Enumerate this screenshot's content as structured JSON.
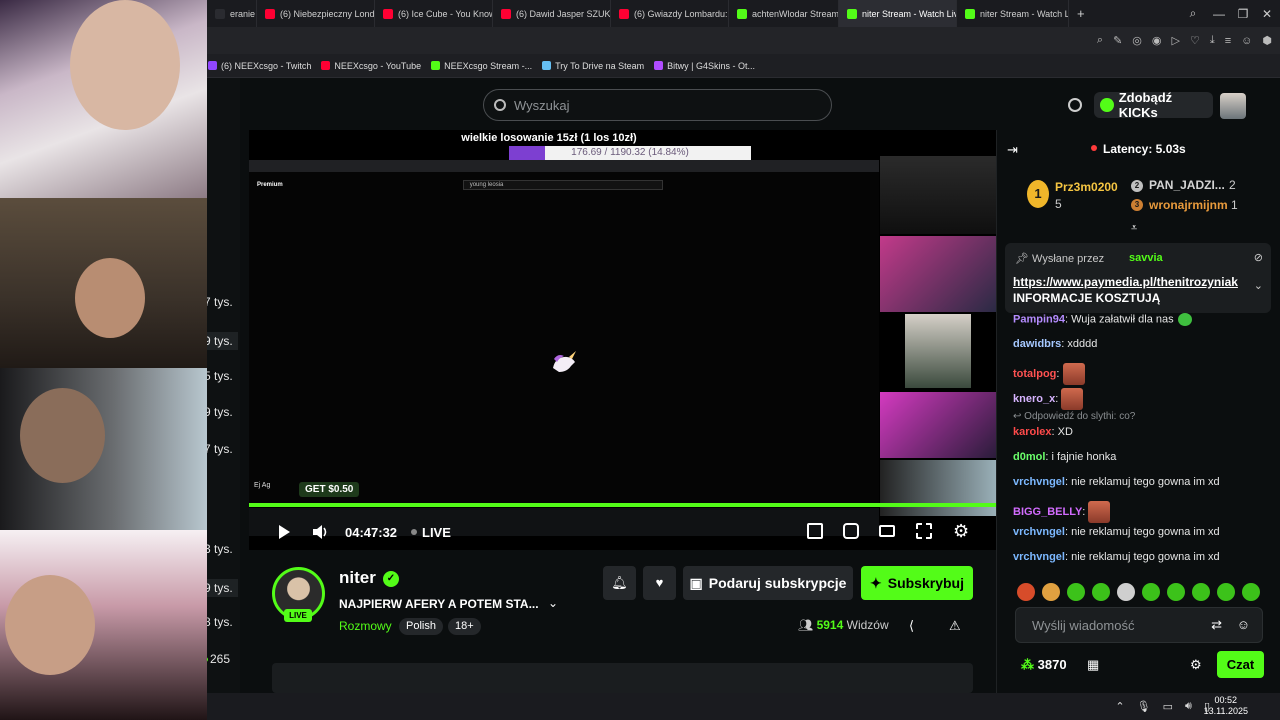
{
  "browser": {
    "tabs": [
      {
        "label": "eranie",
        "color": "#2a2b30",
        "active": false
      },
      {
        "label": "(6) Niebezpieczny Londyn",
        "color": "#ff0033",
        "active": false
      },
      {
        "label": "(6) Ice Cube - You Know H",
        "color": "#ff0033",
        "active": false
      },
      {
        "label": "(6) Dawid Jasper SZUKAN",
        "color": "#ff0033",
        "active": false
      },
      {
        "label": "(6) Gwiazdy Lombardu: Pa",
        "color": "#ff0033",
        "active": false
      },
      {
        "label": "achtenWlodar Stream - W",
        "color": "#53fc18",
        "active": false
      },
      {
        "label": "niter Stream - Watch Live",
        "color": "#53fc18",
        "active": true
      },
      {
        "label": "niter Stream - Watch Live",
        "color": "#53fc18",
        "active": false
      }
    ],
    "new_tab": "+",
    "bookmarks": [
      {
        "label": "(6) NEEXcsgo - Twitch",
        "color": "#9146ff"
      },
      {
        "label": "NEEXcsgo - YouTube",
        "color": "#ff0033"
      },
      {
        "label": "NEEXcsgo Stream -...",
        "color": "#53fc18"
      },
      {
        "label": "Try To Drive na Steam",
        "color": "#66c0f4"
      },
      {
        "label": "Bitwy | G4Skins - Ot...",
        "color": "#b04cff"
      }
    ]
  },
  "left_viewers": [
    "7 tys.",
    "9 tys.",
    "5 tys.",
    "9 tys.",
    "7 tys.",
    "3 tys.",
    "9 tys.",
    "8 tys.",
    "265"
  ],
  "header": {
    "search_placeholder": "Wyszukaj",
    "get_kicks": "Zdobądź KICKs"
  },
  "video": {
    "overlay_title": "wielkie losowanie 15zł (1 los 10zł)",
    "overlay_progress_text": "176.69 / 1190.32 (14.84%)",
    "overlay_progress": 0.1484,
    "yt_premium": "Premium",
    "yt_query": "young leosia",
    "ej_text": "Ej Ag",
    "get_text": "GET $0.50",
    "time": "04:47:32",
    "live": "LIVE"
  },
  "channel": {
    "name": "niter",
    "title": "NAJPIERW AFERY A POTEM STA...",
    "category": "Rozmowy",
    "tags": [
      "Polish",
      "18+"
    ],
    "live_badge": "LIVE",
    "gift_label": "Podaruj subskrypcje",
    "subscribe_label": "Subskrybuj",
    "viewers_count": "5914",
    "viewers_label": "Widzów"
  },
  "chat": {
    "latency": "Latency: 5.03s",
    "leaderboard": [
      {
        "name": "Prz3m0200",
        "count": "5",
        "rank": "1"
      },
      {
        "name": "PAN_JADZI...",
        "count": "2",
        "rank": "2"
      },
      {
        "name": "wronajrmijnm",
        "count": "1",
        "rank": "3"
      }
    ],
    "pinned_by_label": "Wysłane przez",
    "pinned_by_user": "savvia",
    "pinned_link": "https://www.paymedia.pl/thenitrozyniak",
    "pinned_text": "INFORMACJE KOSZTUJĄ",
    "messages": [
      {
        "user": "Pampin94",
        "color": "#b58cff",
        "text": "Wuja załatwił dla nas"
      },
      {
        "user": "dawidbrs",
        "color": "#a6c8ff",
        "text": "xdddd"
      },
      {
        "user": "totalpog",
        "color": "#ff5252",
        "text": ""
      },
      {
        "user": "knero_x",
        "color": "#d7b4ff",
        "text": ""
      },
      {
        "user": "karolex",
        "color": "#ff4a4a",
        "text": "XD"
      },
      {
        "user": "d0mol",
        "color": "#6bff6b",
        "text": "i fajnie honka"
      },
      {
        "user": "vrchvngel",
        "color": "#7cb8ff",
        "text": "nie reklamuj tego gowna im xd"
      },
      {
        "user": "BIGG_BELLY",
        "color": "#d36cff",
        "text": ""
      },
      {
        "user": "vrchvngel",
        "color": "#7cb8ff",
        "text": "nie reklamuj tego gowna im xd"
      },
      {
        "user": "vrchvngel",
        "color": "#7cb8ff",
        "text": "nie reklamuj tego gowna im xd"
      }
    ],
    "reply_text": "Odpowiedź do slythi: co?",
    "input_placeholder": "Wyślij wiadomość",
    "kicks_balance": "3870",
    "send_label": "Czat"
  },
  "taskbar": {
    "time": "00:52",
    "date": "13.11.2025"
  }
}
